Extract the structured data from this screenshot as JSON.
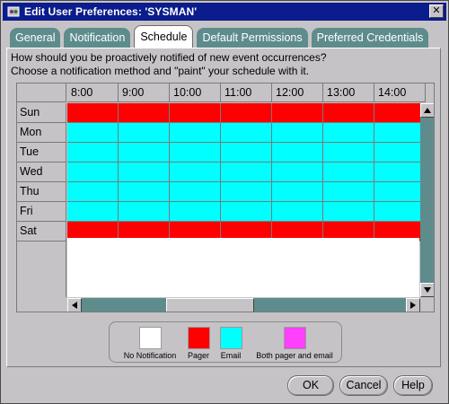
{
  "window": {
    "title": "Edit User Preferences: 'SYSMAN'",
    "close_glyph": "✕"
  },
  "tabs": [
    {
      "label": "General",
      "active": false
    },
    {
      "label": "Notification",
      "active": false
    },
    {
      "label": "Schedule",
      "active": true
    },
    {
      "label": "Default Permissions",
      "active": false
    },
    {
      "label": "Preferred Credentials",
      "active": false
    }
  ],
  "instructions": {
    "line1": "How should you be proactively notified of new event occurrences?",
    "line2": "Choose a notification method and \"paint\" your schedule with it."
  },
  "schedule": {
    "hours": [
      "8:00",
      "9:00",
      "10:00",
      "11:00",
      "12:00",
      "13:00",
      "14:00"
    ],
    "days": [
      {
        "label": "Sun",
        "method": "pager"
      },
      {
        "label": "Mon",
        "method": "email"
      },
      {
        "label": "Tue",
        "method": "email"
      },
      {
        "label": "Wed",
        "method": "email"
      },
      {
        "label": "Thu",
        "method": "email"
      },
      {
        "label": "Fri",
        "method": "email"
      },
      {
        "label": "Sat",
        "method": "pager"
      }
    ]
  },
  "legend": {
    "items": [
      {
        "key": "none",
        "label": "No Notification",
        "color": "#ffffff"
      },
      {
        "key": "pager",
        "label": "Pager",
        "color": "#ff0000"
      },
      {
        "key": "email",
        "label": "Email",
        "color": "#00ffff"
      },
      {
        "key": "both",
        "label": "Both pager and email",
        "color": "#ff40ff"
      }
    ]
  },
  "buttons": {
    "ok": "OK",
    "cancel": "Cancel",
    "help": "Help"
  },
  "colors": {
    "titlebar": "#0b1c8c",
    "tab_inactive": "#5e8c8c",
    "scroll_track": "#5e8c8c",
    "chrome": "#c6c3c6"
  }
}
